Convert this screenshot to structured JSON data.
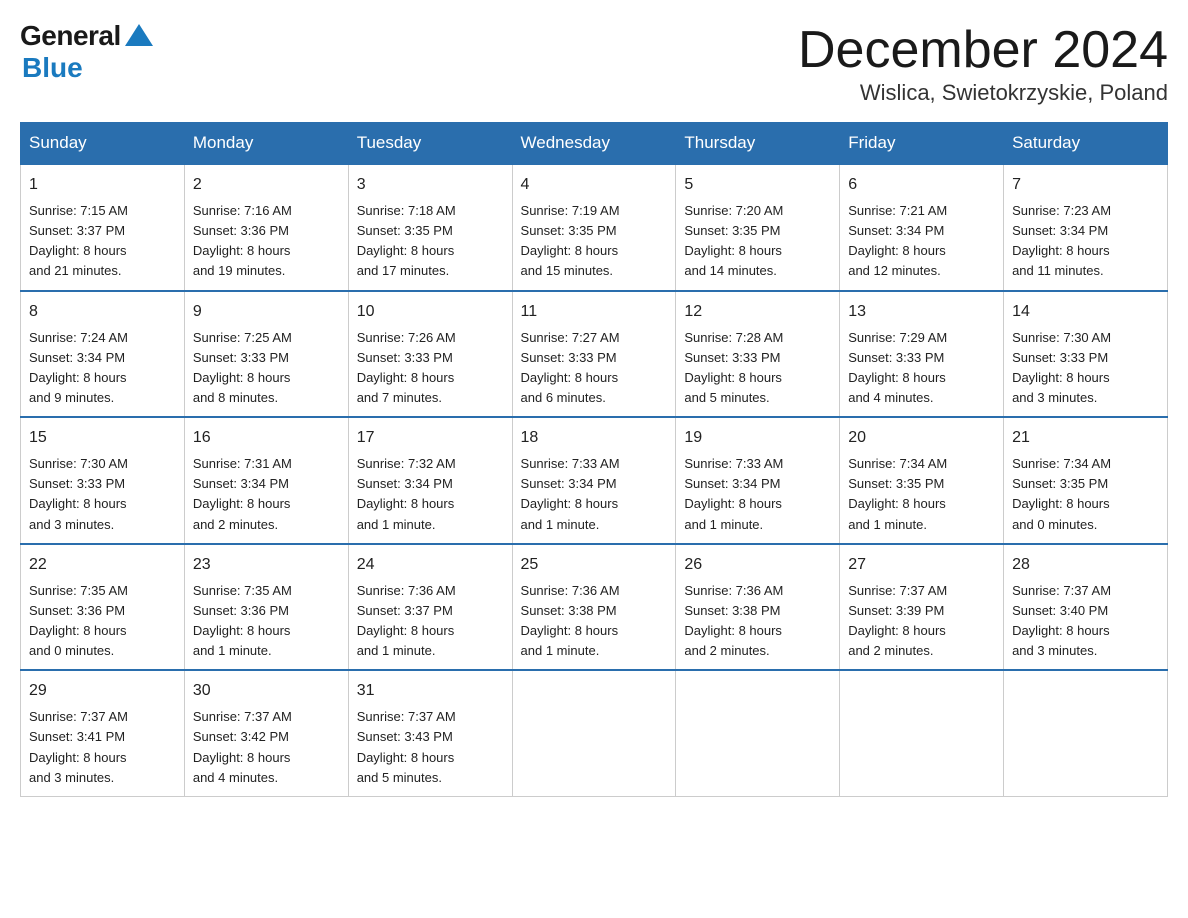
{
  "logo": {
    "general": "General",
    "blue": "Blue"
  },
  "title": "December 2024",
  "location": "Wislica, Swietokrzyskie, Poland",
  "weekdays": [
    "Sunday",
    "Monday",
    "Tuesday",
    "Wednesday",
    "Thursday",
    "Friday",
    "Saturday"
  ],
  "weeks": [
    [
      {
        "day": "1",
        "info": "Sunrise: 7:15 AM\nSunset: 3:37 PM\nDaylight: 8 hours\nand 21 minutes."
      },
      {
        "day": "2",
        "info": "Sunrise: 7:16 AM\nSunset: 3:36 PM\nDaylight: 8 hours\nand 19 minutes."
      },
      {
        "day": "3",
        "info": "Sunrise: 7:18 AM\nSunset: 3:35 PM\nDaylight: 8 hours\nand 17 minutes."
      },
      {
        "day": "4",
        "info": "Sunrise: 7:19 AM\nSunset: 3:35 PM\nDaylight: 8 hours\nand 15 minutes."
      },
      {
        "day": "5",
        "info": "Sunrise: 7:20 AM\nSunset: 3:35 PM\nDaylight: 8 hours\nand 14 minutes."
      },
      {
        "day": "6",
        "info": "Sunrise: 7:21 AM\nSunset: 3:34 PM\nDaylight: 8 hours\nand 12 minutes."
      },
      {
        "day": "7",
        "info": "Sunrise: 7:23 AM\nSunset: 3:34 PM\nDaylight: 8 hours\nand 11 minutes."
      }
    ],
    [
      {
        "day": "8",
        "info": "Sunrise: 7:24 AM\nSunset: 3:34 PM\nDaylight: 8 hours\nand 9 minutes."
      },
      {
        "day": "9",
        "info": "Sunrise: 7:25 AM\nSunset: 3:33 PM\nDaylight: 8 hours\nand 8 minutes."
      },
      {
        "day": "10",
        "info": "Sunrise: 7:26 AM\nSunset: 3:33 PM\nDaylight: 8 hours\nand 7 minutes."
      },
      {
        "day": "11",
        "info": "Sunrise: 7:27 AM\nSunset: 3:33 PM\nDaylight: 8 hours\nand 6 minutes."
      },
      {
        "day": "12",
        "info": "Sunrise: 7:28 AM\nSunset: 3:33 PM\nDaylight: 8 hours\nand 5 minutes."
      },
      {
        "day": "13",
        "info": "Sunrise: 7:29 AM\nSunset: 3:33 PM\nDaylight: 8 hours\nand 4 minutes."
      },
      {
        "day": "14",
        "info": "Sunrise: 7:30 AM\nSunset: 3:33 PM\nDaylight: 8 hours\nand 3 minutes."
      }
    ],
    [
      {
        "day": "15",
        "info": "Sunrise: 7:30 AM\nSunset: 3:33 PM\nDaylight: 8 hours\nand 3 minutes."
      },
      {
        "day": "16",
        "info": "Sunrise: 7:31 AM\nSunset: 3:34 PM\nDaylight: 8 hours\nand 2 minutes."
      },
      {
        "day": "17",
        "info": "Sunrise: 7:32 AM\nSunset: 3:34 PM\nDaylight: 8 hours\nand 1 minute."
      },
      {
        "day": "18",
        "info": "Sunrise: 7:33 AM\nSunset: 3:34 PM\nDaylight: 8 hours\nand 1 minute."
      },
      {
        "day": "19",
        "info": "Sunrise: 7:33 AM\nSunset: 3:34 PM\nDaylight: 8 hours\nand 1 minute."
      },
      {
        "day": "20",
        "info": "Sunrise: 7:34 AM\nSunset: 3:35 PM\nDaylight: 8 hours\nand 1 minute."
      },
      {
        "day": "21",
        "info": "Sunrise: 7:34 AM\nSunset: 3:35 PM\nDaylight: 8 hours\nand 0 minutes."
      }
    ],
    [
      {
        "day": "22",
        "info": "Sunrise: 7:35 AM\nSunset: 3:36 PM\nDaylight: 8 hours\nand 0 minutes."
      },
      {
        "day": "23",
        "info": "Sunrise: 7:35 AM\nSunset: 3:36 PM\nDaylight: 8 hours\nand 1 minute."
      },
      {
        "day": "24",
        "info": "Sunrise: 7:36 AM\nSunset: 3:37 PM\nDaylight: 8 hours\nand 1 minute."
      },
      {
        "day": "25",
        "info": "Sunrise: 7:36 AM\nSunset: 3:38 PM\nDaylight: 8 hours\nand 1 minute."
      },
      {
        "day": "26",
        "info": "Sunrise: 7:36 AM\nSunset: 3:38 PM\nDaylight: 8 hours\nand 2 minutes."
      },
      {
        "day": "27",
        "info": "Sunrise: 7:37 AM\nSunset: 3:39 PM\nDaylight: 8 hours\nand 2 minutes."
      },
      {
        "day": "28",
        "info": "Sunrise: 7:37 AM\nSunset: 3:40 PM\nDaylight: 8 hours\nand 3 minutes."
      }
    ],
    [
      {
        "day": "29",
        "info": "Sunrise: 7:37 AM\nSunset: 3:41 PM\nDaylight: 8 hours\nand 3 minutes."
      },
      {
        "day": "30",
        "info": "Sunrise: 7:37 AM\nSunset: 3:42 PM\nDaylight: 8 hours\nand 4 minutes."
      },
      {
        "day": "31",
        "info": "Sunrise: 7:37 AM\nSunset: 3:43 PM\nDaylight: 8 hours\nand 5 minutes."
      },
      {
        "day": "",
        "info": ""
      },
      {
        "day": "",
        "info": ""
      },
      {
        "day": "",
        "info": ""
      },
      {
        "day": "",
        "info": ""
      }
    ]
  ]
}
